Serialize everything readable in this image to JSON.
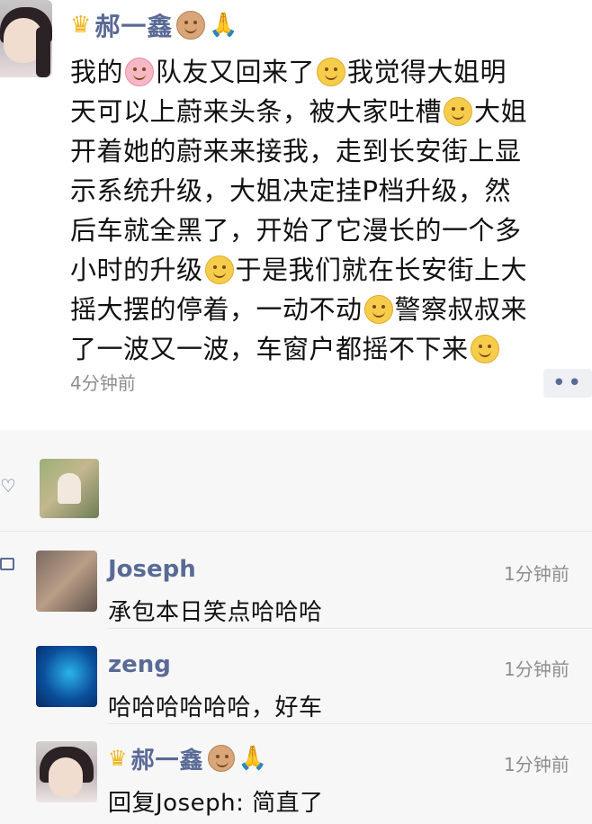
{
  "post": {
    "author": "郝一鑫",
    "text_lines": [
      [
        "我的",
        "{pig}",
        "队友又回来了",
        "{grin}",
        "我觉得大姐明"
      ],
      [
        "天可以上蔚来头条，被大家吐槽",
        "{smile}",
        "大姐"
      ],
      [
        "开着她的蔚来来接我，走到长安街上显"
      ],
      [
        "示系统升级，大姐决定挂P档升级，然"
      ],
      [
        "后车就全黑了，开始了它漫长的一个多"
      ],
      [
        "小时的升级",
        "{smile}",
        "于是我们就在长安街上大"
      ],
      [
        "摇大摆的停着，一动不动",
        "{smile}",
        "警察叔叔来"
      ],
      [
        "了一波又一波，车窗户都摇不下来",
        "{smile}"
      ]
    ],
    "time": "4分钟前",
    "more_label": "••"
  },
  "comments": [
    {
      "name": "Joseph",
      "time": "1分钟前",
      "text": "承包本日笑点哈哈哈"
    },
    {
      "name": "zeng",
      "time": "1分钟前",
      "text": "哈哈哈哈哈哈，好车"
    },
    {
      "name": "郝一鑫",
      "time": "1分钟前",
      "text": "回复Joseph: 简直了"
    }
  ],
  "icons": {
    "crown": "crown-emoji",
    "monkey": "monkey-emoji",
    "pray": "pray-emoji",
    "heart": "heart-icon",
    "comment": "comment-icon"
  },
  "colors": {
    "name": "#5a6a96",
    "time": "#8e8e8e",
    "comment_bg": "#f7f7f7"
  }
}
